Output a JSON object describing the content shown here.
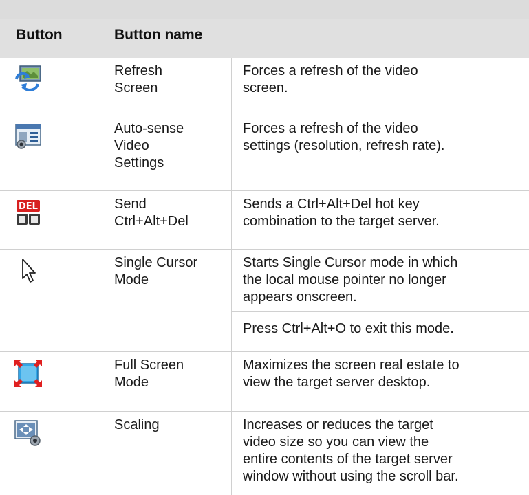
{
  "table": {
    "headers": [
      "Button",
      "Button name"
    ],
    "rows": [
      {
        "icon": "refresh-screen-icon",
        "name": "Refresh\nScreen",
        "description": "Forces a refresh of the video\nscreen."
      },
      {
        "icon": "auto-sense-video-icon",
        "name": "Auto-sense\nVideo\nSettings",
        "description": "Forces a refresh of the video\nsettings (resolution, refresh rate)."
      },
      {
        "icon": "ctrl-alt-del-icon",
        "name": "Send\nCtrl+Alt+Del",
        "description": "Sends a Ctrl+Alt+Del hot key\ncombination to the target server."
      },
      {
        "icon": "cursor-arrow-icon",
        "name": "Single Cursor\nMode",
        "description": "Starts Single Cursor mode in which\nthe local mouse pointer no longer\nappears onscreen.",
        "note": "Press Ctrl+Alt+O to exit this mode."
      },
      {
        "icon": "full-screen-icon",
        "name": "Full Screen\nMode",
        "description": "Maximizes the screen real estate to\nview the target server desktop."
      },
      {
        "icon": "scaling-icon",
        "name": "Scaling",
        "description": "Increases or reduces the target\nvideo size so you can view the\nentire contents of the target server\nwindow without using the scroll bar."
      }
    ]
  }
}
